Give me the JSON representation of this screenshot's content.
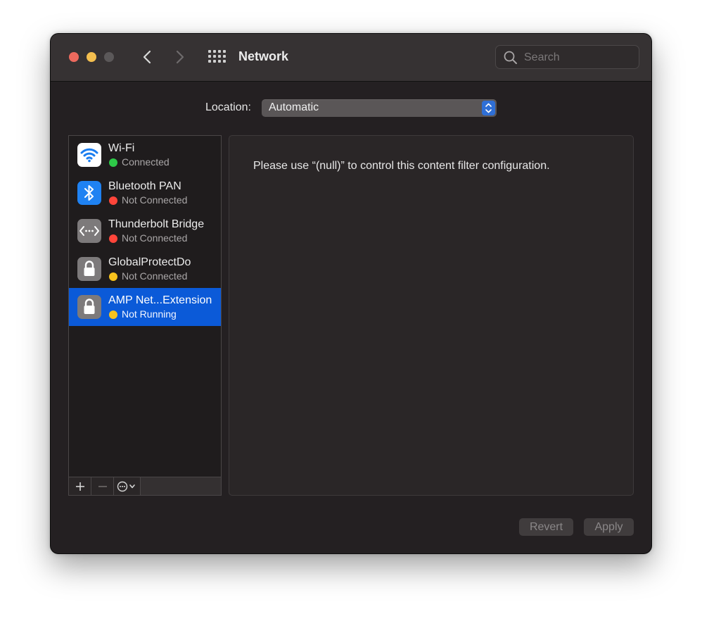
{
  "window": {
    "title": "Network",
    "search_placeholder": "Search"
  },
  "icons": {
    "back": "chevron-left-icon",
    "forward": "chevron-right-icon",
    "show_all": "grid-icon",
    "search": "magnifier-icon"
  },
  "location": {
    "label": "Location:",
    "value": "Automatic"
  },
  "services": [
    {
      "name": "Wi-Fi",
      "status": "Connected",
      "status_color": "#2ec948",
      "icon": "wifi-icon",
      "selected": false
    },
    {
      "name": "Bluetooth PAN",
      "status": "Not Connected",
      "status_color": "#ff453a",
      "icon": "bluetooth-icon",
      "selected": false
    },
    {
      "name": "Thunderbolt Bridge",
      "status": "Not Connected",
      "status_color": "#ff453a",
      "icon": "thunderbolt-bridge-icon",
      "selected": false
    },
    {
      "name": "GlobalProtectDo",
      "status": "Not Connected",
      "status_color": "#f8c31d",
      "icon": "lock-icon",
      "selected": false
    },
    {
      "name": "AMP Net...Extension",
      "status": "Not Running",
      "status_color": "#f8c31d",
      "icon": "lock-icon",
      "selected": true
    }
  ],
  "sidebar_toolbar": {
    "add": "+",
    "remove": "−"
  },
  "detail": {
    "message": "Please use “(null)” to control this content filter configuration."
  },
  "buttons": {
    "revert": "Revert",
    "apply": "Apply"
  },
  "colors": {
    "accent": "#0b5ad8",
    "window_bg": "#242022",
    "titlebar_bg": "#363233"
  }
}
